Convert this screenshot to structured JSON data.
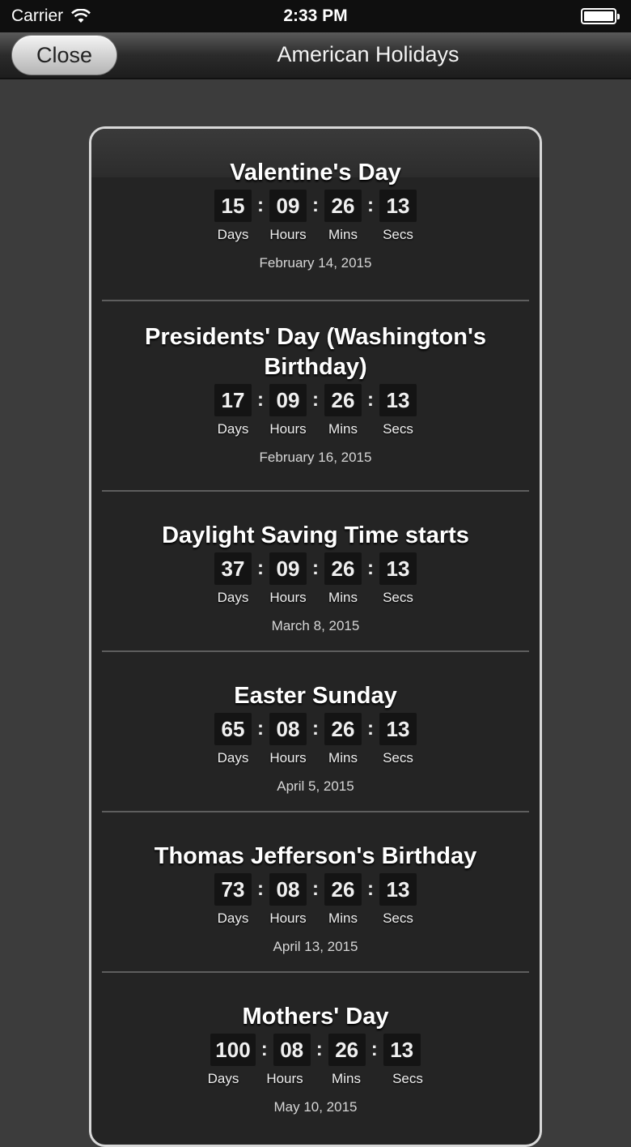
{
  "status_bar": {
    "carrier": "Carrier",
    "time": "2:33 PM"
  },
  "nav": {
    "close_label": "Close",
    "title": "American Holidays"
  },
  "unit_labels": {
    "days": "Days",
    "hours": "Hours",
    "mins": "Mins",
    "secs": "Secs"
  },
  "separator": ":",
  "holidays": [
    {
      "name": "Valentine's Day",
      "days": "15",
      "hours": "09",
      "mins": "26",
      "secs": "13",
      "date": "February 14, 2015"
    },
    {
      "name": "Presidents' Day (Washington's Birthday)",
      "days": "17",
      "hours": "09",
      "mins": "26",
      "secs": "13",
      "date": "February 16, 2015"
    },
    {
      "name": "Daylight Saving Time starts",
      "days": "37",
      "hours": "09",
      "mins": "26",
      "secs": "13",
      "date": "March 8, 2015"
    },
    {
      "name": "Easter Sunday",
      "days": "65",
      "hours": "08",
      "mins": "26",
      "secs": "13",
      "date": "April 5, 2015"
    },
    {
      "name": "Thomas Jefferson's Birthday",
      "days": "73",
      "hours": "08",
      "mins": "26",
      "secs": "13",
      "date": "April 13, 2015"
    },
    {
      "name": "Mothers' Day",
      "days": "100",
      "hours": "08",
      "mins": "26",
      "secs": "13",
      "date": "May 10, 2015"
    }
  ]
}
